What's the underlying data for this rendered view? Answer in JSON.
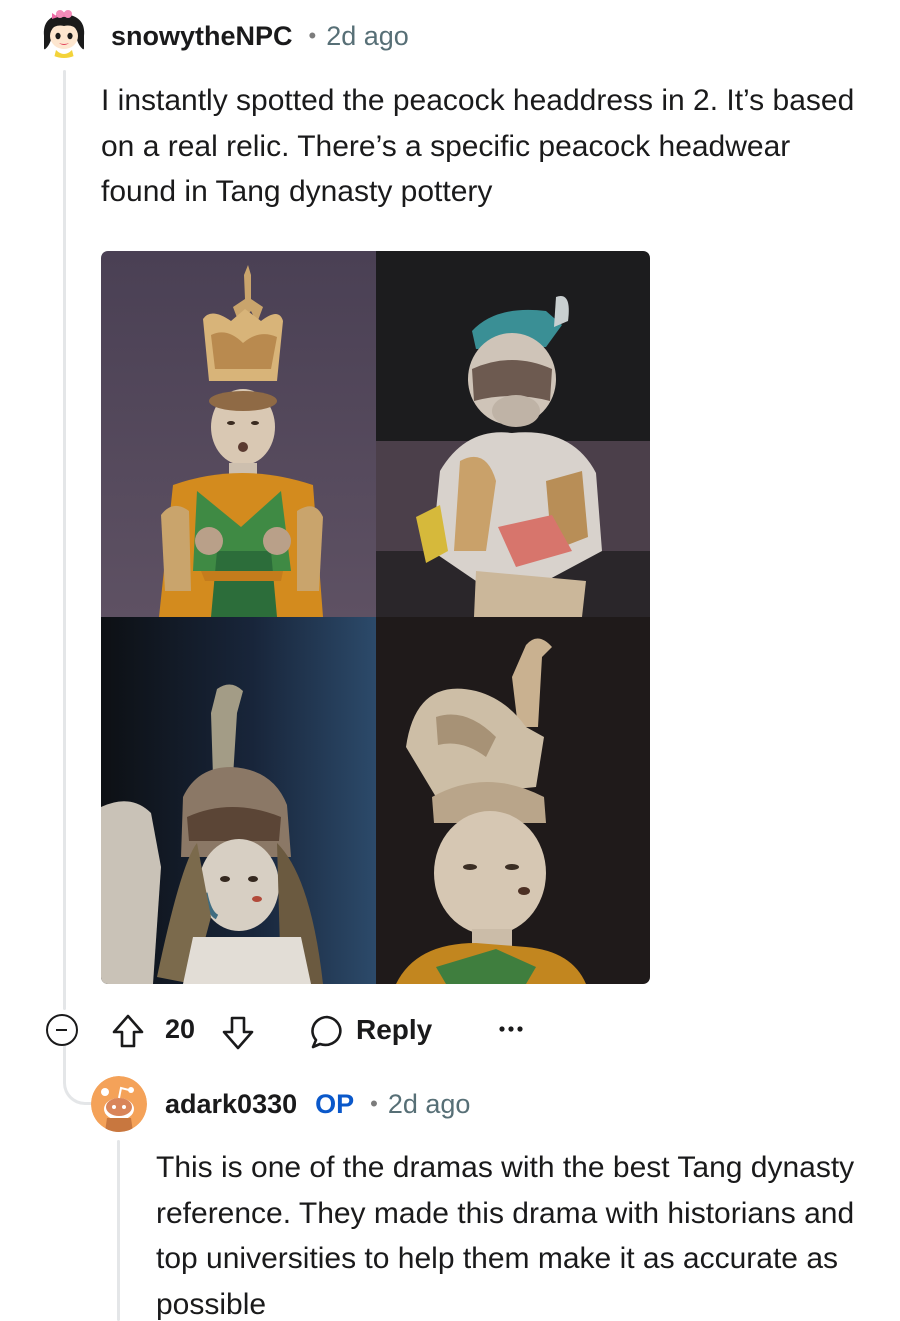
{
  "comment": {
    "username": "snowytheNPC",
    "separator": "•",
    "time": "2d ago",
    "body": "I instantly spotted the peacock headdress in 2. It’s based on a real relic. There’s a specific peacock headwear found in Tang dynasty pottery",
    "image_icons": [
      "tang-figurine-peacock-headdress",
      "tang-figurine-blue-cap",
      "tang-figurine-bird-hat",
      "tang-figurine-peacock-crown"
    ],
    "actions": {
      "vote_count": "20",
      "reply_label": "Reply",
      "more_label": "•••"
    }
  },
  "reply": {
    "username": "adark0330",
    "op_badge": "OP",
    "separator": "•",
    "time": "2d ago",
    "body": "This is one of the dramas with the best Tang dynasty reference. They made this drama with historians and top universities to help them make it as accurate as possible"
  },
  "colors": {
    "accent_blue": "#0a58ca",
    "thread_line": "#e4e6e8",
    "text": "#1a1a1b",
    "muted": "#576f76",
    "reply_avatar": "#f4a259"
  }
}
